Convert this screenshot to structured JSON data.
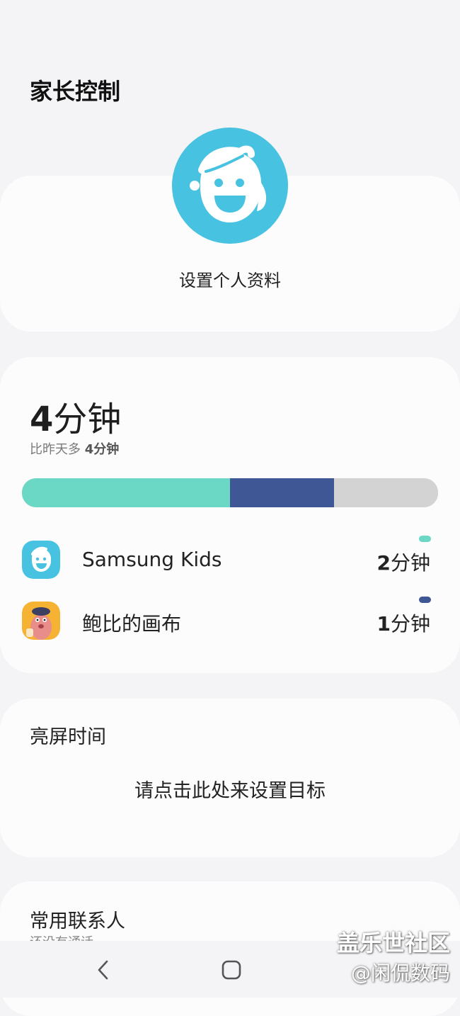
{
  "header": {
    "title": "家长控制"
  },
  "profile": {
    "label": "设置个人资料",
    "avatar_icon": "kid-face-icon",
    "avatar_color": "#47c2e0"
  },
  "usage": {
    "total_value": "4",
    "total_unit": "分钟",
    "compare_prefix": "比昨天多 ",
    "compare_value": "4分钟",
    "bar_segments": [
      {
        "name": "Samsung Kids",
        "fraction": 0.5,
        "color": "#6ad8c4"
      },
      {
        "name": "鲍比的画布",
        "fraction": 0.25,
        "color": "#3f5895"
      },
      {
        "name": "remaining",
        "fraction": 0.25,
        "color": "#d3d3d3"
      }
    ],
    "apps": [
      {
        "name": "Samsung Kids",
        "time_value": "2",
        "time_unit": "分钟",
        "color": "#6ad8c4",
        "icon": "samsung-kids-icon"
      },
      {
        "name": "鲍比的画布",
        "time_value": "1",
        "time_unit": "分钟",
        "color": "#3f5895",
        "icon": "bobby-canvas-icon"
      }
    ]
  },
  "screen_time": {
    "title": "亮屏时间",
    "cta": "请点击此处来设置目标"
  },
  "contacts": {
    "title": "常用联系人",
    "subtitle": "还没有通话"
  },
  "watermark": {
    "line1": "盖乐世社区",
    "line2": "@闲侃数码"
  },
  "navbar": {
    "back_icon": "back-chevron-icon",
    "home_icon": "home-square-icon"
  }
}
